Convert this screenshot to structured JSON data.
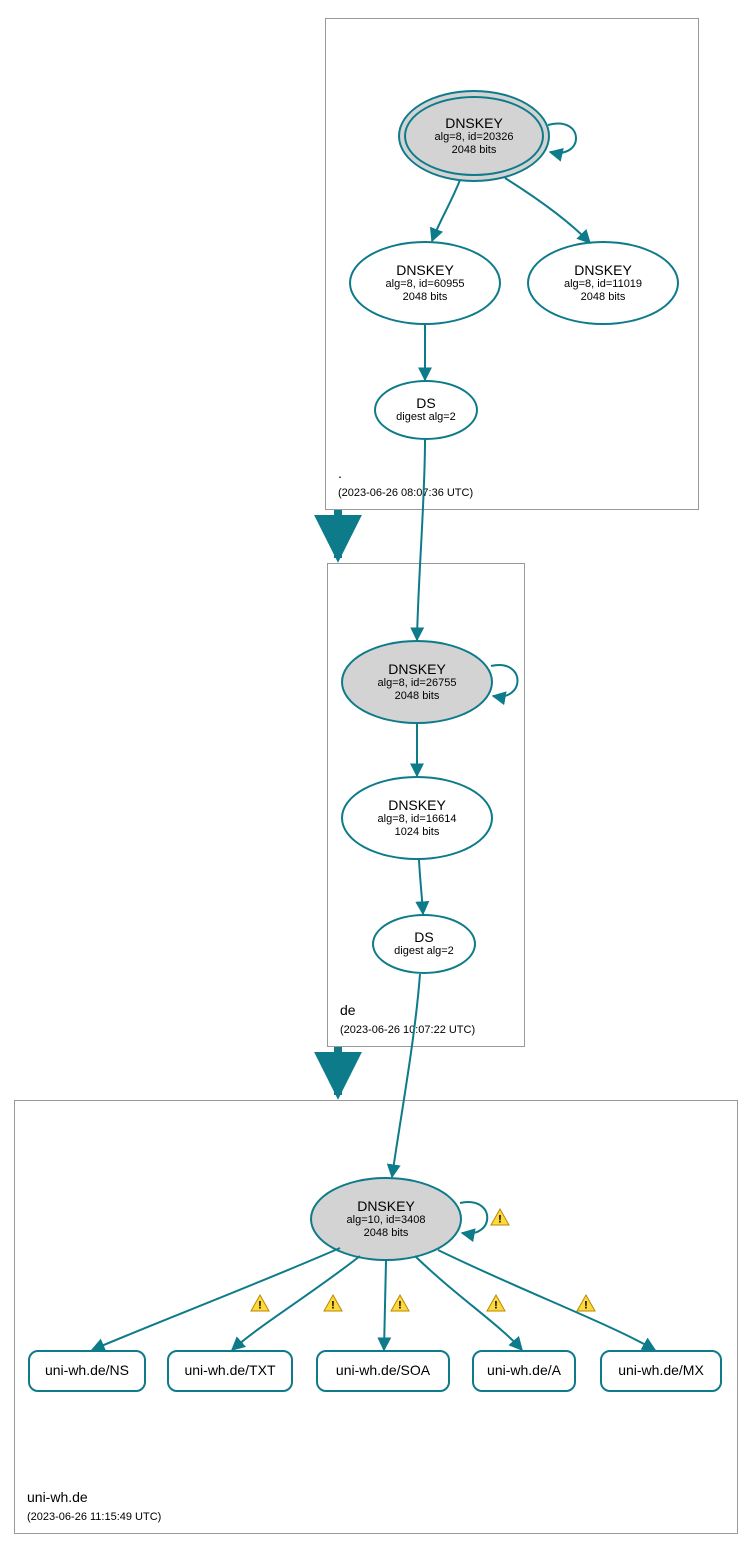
{
  "zones": {
    "root": {
      "label": ".",
      "timestamp": "(2023-06-26 08:07:36 UTC)"
    },
    "de": {
      "label": "de",
      "timestamp": "(2023-06-26 10:07:22 UTC)"
    },
    "uniwh": {
      "label": "uni-wh.de",
      "timestamp": "(2023-06-26 11:15:49 UTC)"
    }
  },
  "nodes": {
    "root_ksk": {
      "title": "DNSKEY",
      "line2": "alg=8, id=20326",
      "line3": "2048 bits"
    },
    "root_zsk1": {
      "title": "DNSKEY",
      "line2": "alg=8, id=60955",
      "line3": "2048 bits"
    },
    "root_zsk2": {
      "title": "DNSKEY",
      "line2": "alg=8, id=11019",
      "line3": "2048 bits"
    },
    "root_ds": {
      "title": "DS",
      "line2": "digest alg=2",
      "line3": ""
    },
    "de_ksk": {
      "title": "DNSKEY",
      "line2": "alg=8, id=26755",
      "line3": "2048 bits"
    },
    "de_zsk": {
      "title": "DNSKEY",
      "line2": "alg=8, id=16614",
      "line3": "1024 bits"
    },
    "de_ds": {
      "title": "DS",
      "line2": "digest alg=2",
      "line3": ""
    },
    "uw_ksk": {
      "title": "DNSKEY",
      "line2": "alg=10, id=3408",
      "line3": "2048 bits"
    },
    "uw_ns": {
      "title": "uni-wh.de/NS"
    },
    "uw_txt": {
      "title": "uni-wh.de/TXT"
    },
    "uw_soa": {
      "title": "uni-wh.de/SOA"
    },
    "uw_a": {
      "title": "uni-wh.de/A"
    },
    "uw_mx": {
      "title": "uni-wh.de/MX"
    }
  },
  "colors": {
    "stroke": "#0d7b8a",
    "warn_fill": "#ffd83c",
    "warn_stroke": "#b58900"
  }
}
